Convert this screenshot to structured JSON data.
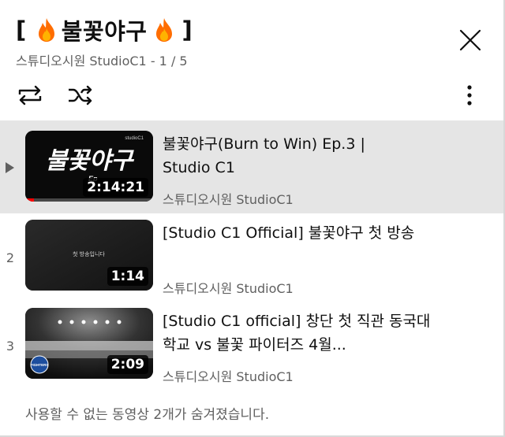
{
  "playlist": {
    "title_open": "[",
    "title_text": "불꽃야구",
    "title_close": "]",
    "channel": "스튜디오시원 StudioC1",
    "position": "1 / 5"
  },
  "icons": {
    "title_emoji": "fire-icon",
    "close": "close-icon",
    "loop": "loop-icon",
    "shuffle": "shuffle-icon",
    "more": "more-vert-icon",
    "now_playing": "play-triangle-icon"
  },
  "videos": [
    {
      "index": "",
      "now_playing": true,
      "title": "불꽃야구(Burn to Win) Ep.3 | Studio C1",
      "channel": "스튜디오시원 StudioC1",
      "duration": "2:14:21",
      "thumb_text": "불꽃야구",
      "thumb_sub": "Ep",
      "thumb_corner": "studioC1",
      "progress": 0.07
    },
    {
      "index": "2",
      "now_playing": false,
      "title": "[Studio C1 Official] 불꽃야구 첫 방송",
      "channel": "스튜디오시원 StudioC1",
      "duration": "1:14",
      "thumb_text": "첫 방송입니다"
    },
    {
      "index": "3",
      "now_playing": false,
      "title": "[Studio C1 official] 창단 첫 직관 동국대학교 vs 불꽃 파이터즈 4월...",
      "channel": "스튜디오시원 StudioC1",
      "duration": "2:09",
      "thumb_text": "FIGHTERS"
    }
  ],
  "hidden_videos_note": "사용할 수 없는 동영상 2개가 숨겨졌습니다.",
  "colors": {
    "active_row": "#e5e5e5",
    "secondary_text": "#606060",
    "progress": "#ff0000",
    "fire": "#ff6d00"
  }
}
